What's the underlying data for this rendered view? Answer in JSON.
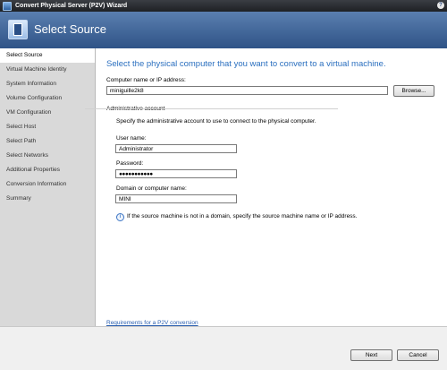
{
  "window": {
    "title": "Convert Physical Server (P2V) Wizard",
    "help_label": "?"
  },
  "header": {
    "title": "Select Source"
  },
  "sidebar": {
    "items": [
      {
        "label": "Select Source"
      },
      {
        "label": "Virtual Machine Identity"
      },
      {
        "label": "System Information"
      },
      {
        "label": "Volume Configuration"
      },
      {
        "label": "VM Configuration"
      },
      {
        "label": "Select Host"
      },
      {
        "label": "Select Path"
      },
      {
        "label": "Select Networks"
      },
      {
        "label": "Additional Properties"
      },
      {
        "label": "Conversion Information"
      },
      {
        "label": "Summary"
      }
    ]
  },
  "main": {
    "heading": "Select the physical computer that you want to convert to a virtual machine.",
    "computer_label": "Computer name or IP address:",
    "computer_value": "miniguille2k8",
    "browse_label": "Browse...",
    "admin_group_label": "Administrative account",
    "admin_desc": "Specify the administrative account to use to connect to the physical computer.",
    "username_label": "User name:",
    "username_value": "Administrator",
    "password_label": "Password:",
    "password_value": "●●●●●●●●●●●",
    "domain_label": "Domain or computer name:",
    "domain_value": "MINI",
    "info_text": "If the source machine is not in a domain, specify the source machine name or IP address.",
    "requirements_link": "Requirements for a P2V conversion"
  },
  "footer": {
    "next_label": "Next",
    "cancel_label": "Cancel"
  },
  "colors": {
    "accent": "#2a6fbf",
    "header_bg": "#2f5387"
  }
}
